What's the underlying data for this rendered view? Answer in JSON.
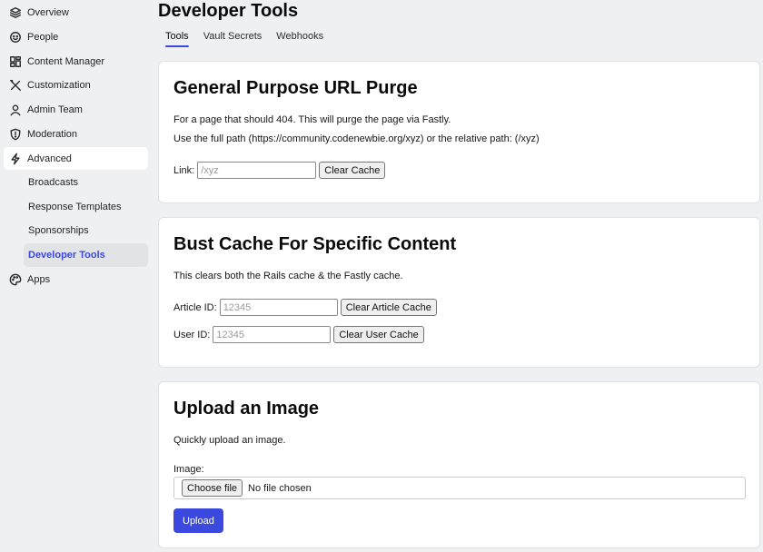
{
  "sidebar": {
    "items": [
      {
        "label": "Overview",
        "icon": "layers-icon"
      },
      {
        "label": "People",
        "icon": "smile-icon"
      },
      {
        "label": "Content Manager",
        "icon": "layout-icon"
      },
      {
        "label": "Customization",
        "icon": "tools-icon"
      },
      {
        "label": "Admin Team",
        "icon": "user-icon"
      },
      {
        "label": "Moderation",
        "icon": "shield-icon"
      },
      {
        "label": "Advanced",
        "icon": "bolt-icon"
      },
      {
        "label": "Apps",
        "icon": "palette-icon"
      }
    ],
    "subitems": [
      {
        "label": "Broadcasts"
      },
      {
        "label": "Response Templates"
      },
      {
        "label": "Sponsorships"
      },
      {
        "label": "Developer Tools"
      }
    ]
  },
  "header": {
    "title": "Developer Tools",
    "tabs": [
      {
        "label": "Tools"
      },
      {
        "label": "Vault Secrets"
      },
      {
        "label": "Webhooks"
      }
    ]
  },
  "url_purge": {
    "title": "General Purpose URL Purge",
    "desc1": "For a page that should 404. This will purge the page via Fastly.",
    "desc2": "Use the full path (https://community.codenewbie.org/xyz) or the relative path: (/xyz)",
    "link_label": "Link:",
    "link_placeholder": "/xyz",
    "button": "Clear Cache"
  },
  "bust_cache": {
    "title": "Bust Cache For Specific Content",
    "desc": "This clears both the Rails cache & the Fastly cache.",
    "article_label": "Article ID:",
    "article_placeholder": "12345",
    "article_button": "Clear Article Cache",
    "user_label": "User ID:",
    "user_placeholder": "12345",
    "user_button": "Clear User Cache"
  },
  "upload": {
    "title": "Upload an Image",
    "desc": "Quickly upload an image.",
    "image_label": "Image:",
    "choose_button": "Choose file",
    "file_status": "No file chosen",
    "upload_button": "Upload"
  },
  "colors": {
    "accent": "#3b49df",
    "background": "#eef0f1",
    "card": "#ffffff"
  }
}
